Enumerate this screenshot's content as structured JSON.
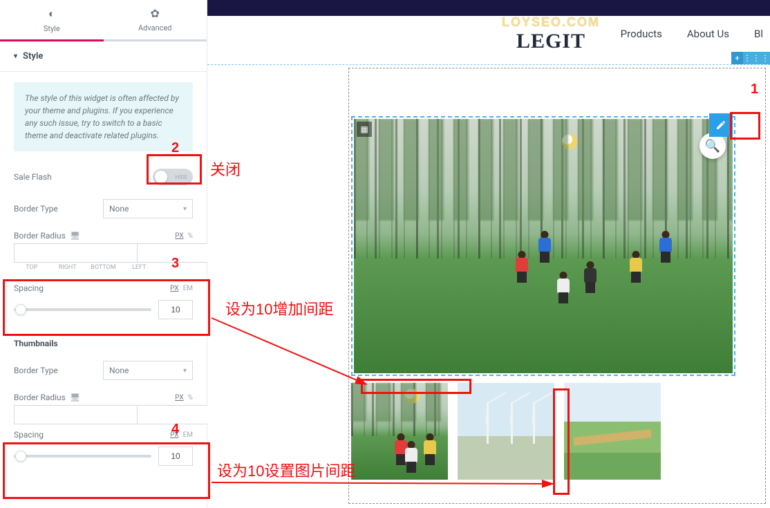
{
  "tabs": {
    "style": "Style",
    "advanced": "Advanced"
  },
  "section_title": "Style",
  "notice": "The style of this widget is often affected by your theme and plugins. If you experience any such issue, try to switch to a basic theme and deactivate related plugins.",
  "sale_flash": {
    "label": "Sale Flash",
    "state": "HIDE"
  },
  "main_img": {
    "border_type_label": "Border Type",
    "border_type_value": "None",
    "border_radius_label": "Border Radius",
    "units": {
      "px": "PX",
      "pct": "%",
      "em": "EM"
    },
    "radius_sides": {
      "top": "TOP",
      "right": "RIGHT",
      "bottom": "BOTTOM",
      "left": "LEFT"
    },
    "spacing_label": "Spacing",
    "spacing_value": "10"
  },
  "thumbs": {
    "title": "Thumbnails",
    "border_type_label": "Border Type",
    "border_type_value": "None",
    "border_radius_label": "Border Radius",
    "spacing_label": "Spacing",
    "spacing_value": "10"
  },
  "brand": {
    "watermark": "LOYSEO.COM",
    "name": "LEGIT"
  },
  "nav": {
    "products": "Products",
    "about": "About Us",
    "blog": "Bl"
  },
  "annotations": {
    "n1": "1",
    "n2": "2",
    "n3": "3",
    "n4": "4",
    "close": "关闭",
    "line3": "设为10增加间距",
    "line4": "设为10设置图片间距"
  }
}
